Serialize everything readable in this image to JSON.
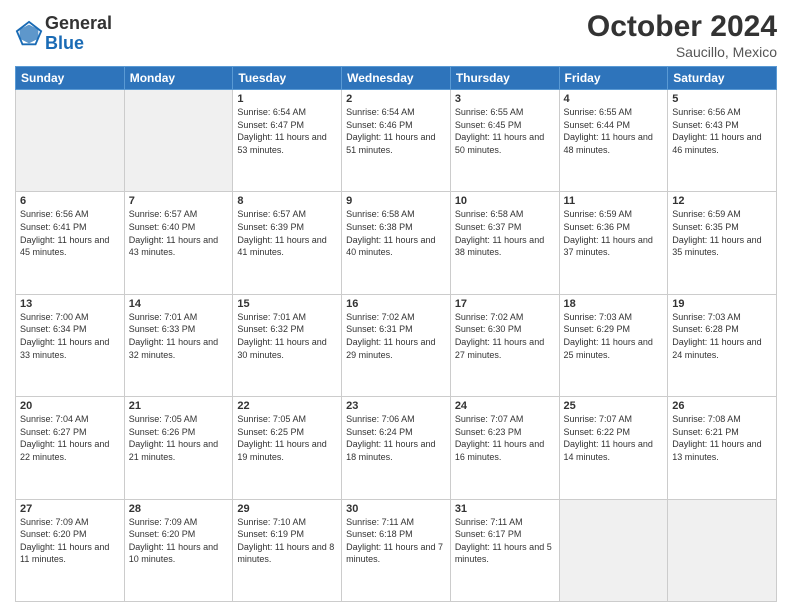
{
  "header": {
    "logo": {
      "general": "General",
      "blue": "Blue"
    },
    "title": "October 2024",
    "location": "Saucillo, Mexico"
  },
  "days_of_week": [
    "Sunday",
    "Monday",
    "Tuesday",
    "Wednesday",
    "Thursday",
    "Friday",
    "Saturday"
  ],
  "weeks": [
    [
      {
        "day": null,
        "empty": true
      },
      {
        "day": null,
        "empty": true
      },
      {
        "day": 1,
        "info": "Sunrise: 6:54 AM\nSunset: 6:47 PM\nDaylight: 11 hours\nand 53 minutes."
      },
      {
        "day": 2,
        "info": "Sunrise: 6:54 AM\nSunset: 6:46 PM\nDaylight: 11 hours\nand 51 minutes."
      },
      {
        "day": 3,
        "info": "Sunrise: 6:55 AM\nSunset: 6:45 PM\nDaylight: 11 hours\nand 50 minutes."
      },
      {
        "day": 4,
        "info": "Sunrise: 6:55 AM\nSunset: 6:44 PM\nDaylight: 11 hours\nand 48 minutes."
      },
      {
        "day": 5,
        "info": "Sunrise: 6:56 AM\nSunset: 6:43 PM\nDaylight: 11 hours\nand 46 minutes."
      }
    ],
    [
      {
        "day": 6,
        "info": "Sunrise: 6:56 AM\nSunset: 6:41 PM\nDaylight: 11 hours\nand 45 minutes."
      },
      {
        "day": 7,
        "info": "Sunrise: 6:57 AM\nSunset: 6:40 PM\nDaylight: 11 hours\nand 43 minutes."
      },
      {
        "day": 8,
        "info": "Sunrise: 6:57 AM\nSunset: 6:39 PM\nDaylight: 11 hours\nand 41 minutes."
      },
      {
        "day": 9,
        "info": "Sunrise: 6:58 AM\nSunset: 6:38 PM\nDaylight: 11 hours\nand 40 minutes."
      },
      {
        "day": 10,
        "info": "Sunrise: 6:58 AM\nSunset: 6:37 PM\nDaylight: 11 hours\nand 38 minutes."
      },
      {
        "day": 11,
        "info": "Sunrise: 6:59 AM\nSunset: 6:36 PM\nDaylight: 11 hours\nand 37 minutes."
      },
      {
        "day": 12,
        "info": "Sunrise: 6:59 AM\nSunset: 6:35 PM\nDaylight: 11 hours\nand 35 minutes."
      }
    ],
    [
      {
        "day": 13,
        "info": "Sunrise: 7:00 AM\nSunset: 6:34 PM\nDaylight: 11 hours\nand 33 minutes."
      },
      {
        "day": 14,
        "info": "Sunrise: 7:01 AM\nSunset: 6:33 PM\nDaylight: 11 hours\nand 32 minutes."
      },
      {
        "day": 15,
        "info": "Sunrise: 7:01 AM\nSunset: 6:32 PM\nDaylight: 11 hours\nand 30 minutes."
      },
      {
        "day": 16,
        "info": "Sunrise: 7:02 AM\nSunset: 6:31 PM\nDaylight: 11 hours\nand 29 minutes."
      },
      {
        "day": 17,
        "info": "Sunrise: 7:02 AM\nSunset: 6:30 PM\nDaylight: 11 hours\nand 27 minutes."
      },
      {
        "day": 18,
        "info": "Sunrise: 7:03 AM\nSunset: 6:29 PM\nDaylight: 11 hours\nand 25 minutes."
      },
      {
        "day": 19,
        "info": "Sunrise: 7:03 AM\nSunset: 6:28 PM\nDaylight: 11 hours\nand 24 minutes."
      }
    ],
    [
      {
        "day": 20,
        "info": "Sunrise: 7:04 AM\nSunset: 6:27 PM\nDaylight: 11 hours\nand 22 minutes."
      },
      {
        "day": 21,
        "info": "Sunrise: 7:05 AM\nSunset: 6:26 PM\nDaylight: 11 hours\nand 21 minutes."
      },
      {
        "day": 22,
        "info": "Sunrise: 7:05 AM\nSunset: 6:25 PM\nDaylight: 11 hours\nand 19 minutes."
      },
      {
        "day": 23,
        "info": "Sunrise: 7:06 AM\nSunset: 6:24 PM\nDaylight: 11 hours\nand 18 minutes."
      },
      {
        "day": 24,
        "info": "Sunrise: 7:07 AM\nSunset: 6:23 PM\nDaylight: 11 hours\nand 16 minutes."
      },
      {
        "day": 25,
        "info": "Sunrise: 7:07 AM\nSunset: 6:22 PM\nDaylight: 11 hours\nand 14 minutes."
      },
      {
        "day": 26,
        "info": "Sunrise: 7:08 AM\nSunset: 6:21 PM\nDaylight: 11 hours\nand 13 minutes."
      }
    ],
    [
      {
        "day": 27,
        "info": "Sunrise: 7:09 AM\nSunset: 6:20 PM\nDaylight: 11 hours\nand 11 minutes."
      },
      {
        "day": 28,
        "info": "Sunrise: 7:09 AM\nSunset: 6:20 PM\nDaylight: 11 hours\nand 10 minutes."
      },
      {
        "day": 29,
        "info": "Sunrise: 7:10 AM\nSunset: 6:19 PM\nDaylight: 11 hours\nand 8 minutes."
      },
      {
        "day": 30,
        "info": "Sunrise: 7:11 AM\nSunset: 6:18 PM\nDaylight: 11 hours\nand 7 minutes."
      },
      {
        "day": 31,
        "info": "Sunrise: 7:11 AM\nSunset: 6:17 PM\nDaylight: 11 hours\nand 5 minutes."
      },
      {
        "day": null,
        "empty": true
      },
      {
        "day": null,
        "empty": true
      }
    ]
  ]
}
